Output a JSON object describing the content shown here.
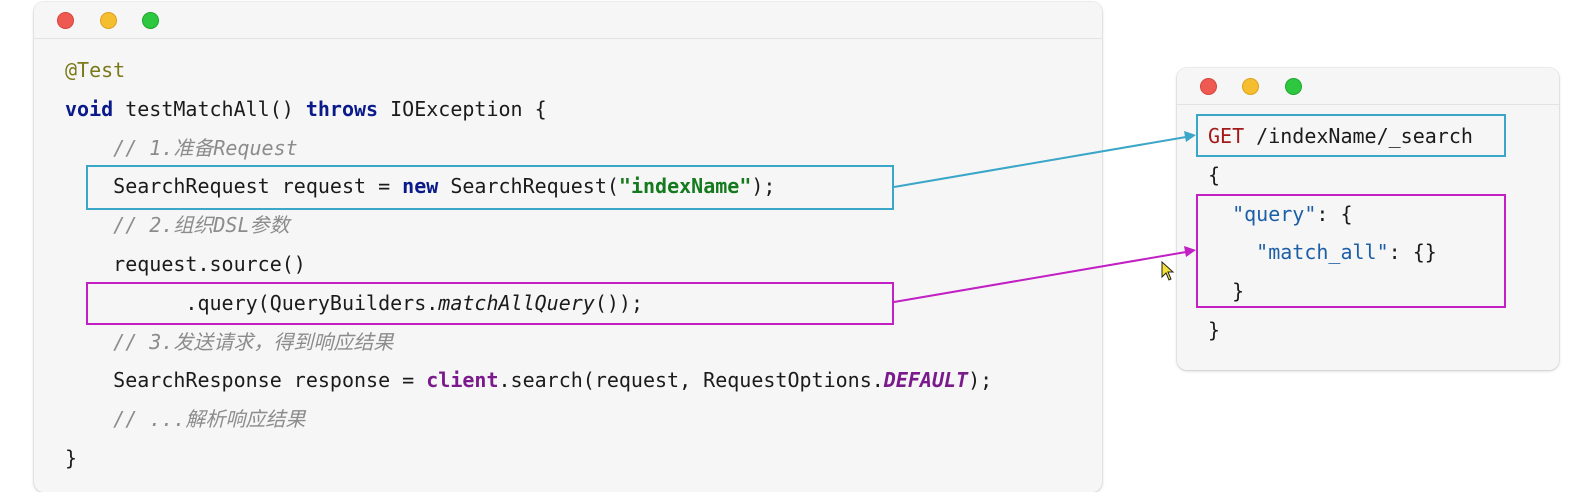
{
  "java_window": {
    "lines": [
      {
        "id": "l1",
        "tokens": [
          {
            "t": "@Test",
            "c": "ann"
          }
        ]
      },
      {
        "id": "l2",
        "tokens": [
          {
            "t": "void",
            "c": "kw"
          },
          {
            "t": " testMatchAll() ",
            "c": ""
          },
          {
            "t": "throws",
            "c": "kw"
          },
          {
            "t": " IOException {",
            "c": ""
          }
        ]
      },
      {
        "id": "l3",
        "tokens": [
          {
            "t": "    // 1.准备Request",
            "c": "cmt"
          }
        ]
      },
      {
        "id": "l4",
        "tokens": [
          {
            "t": "    SearchRequest request = ",
            "c": ""
          },
          {
            "t": "new",
            "c": "kw"
          },
          {
            "t": " SearchRequest(",
            "c": ""
          },
          {
            "t": "\"indexName\"",
            "c": "str"
          },
          {
            "t": ");",
            "c": ""
          }
        ]
      },
      {
        "id": "l5",
        "tokens": [
          {
            "t": "    // 2.组织DSL参数",
            "c": "cmt"
          }
        ]
      },
      {
        "id": "l6",
        "tokens": [
          {
            "t": "    request.source()",
            "c": ""
          }
        ]
      },
      {
        "id": "l7",
        "tokens": [
          {
            "t": "          .query(QueryBuilders.",
            "c": ""
          },
          {
            "t": "matchAllQuery",
            "c": "ital"
          },
          {
            "t": "());",
            "c": ""
          }
        ]
      },
      {
        "id": "l8",
        "tokens": [
          {
            "t": "    // 3.发送请求，得到响应结果",
            "c": "cmt"
          }
        ]
      },
      {
        "id": "l9",
        "tokens": [
          {
            "t": "    SearchResponse response = ",
            "c": ""
          },
          {
            "t": "client",
            "c": "field"
          },
          {
            "t": ".search(request, RequestOptions.",
            "c": ""
          },
          {
            "t": "DEFAULT",
            "c": "fieldit"
          },
          {
            "t": ");",
            "c": ""
          }
        ]
      },
      {
        "id": "l10",
        "tokens": [
          {
            "t": "    // ...解析响应结果",
            "c": "cmt"
          }
        ]
      },
      {
        "id": "l11",
        "tokens": [
          {
            "t": "}",
            "c": ""
          }
        ]
      }
    ]
  },
  "dsl_window": {
    "lines": [
      {
        "id": "d1",
        "tokens": [
          {
            "t": "GET",
            "c": "method"
          },
          {
            "t": " /indexName/_search",
            "c": ""
          }
        ]
      },
      {
        "id": "d2",
        "tokens": [
          {
            "t": "{",
            "c": ""
          }
        ]
      },
      {
        "id": "d3",
        "tokens": [
          {
            "t": "  ",
            "c": ""
          },
          {
            "t": "\"query\"",
            "c": "jkey"
          },
          {
            "t": ": {",
            "c": ""
          }
        ]
      },
      {
        "id": "d4",
        "tokens": [
          {
            "t": "    ",
            "c": ""
          },
          {
            "t": "\"match_all\"",
            "c": "jkey"
          },
          {
            "t": ": {}",
            "c": ""
          }
        ]
      },
      {
        "id": "d5",
        "tokens": [
          {
            "t": "  }",
            "c": ""
          }
        ]
      },
      {
        "id": "d6",
        "tokens": [
          {
            "t": "}",
            "c": ""
          }
        ]
      }
    ]
  },
  "colors": {
    "request_highlight": "#3aa6c8",
    "query_highlight": "#c21fc4"
  }
}
